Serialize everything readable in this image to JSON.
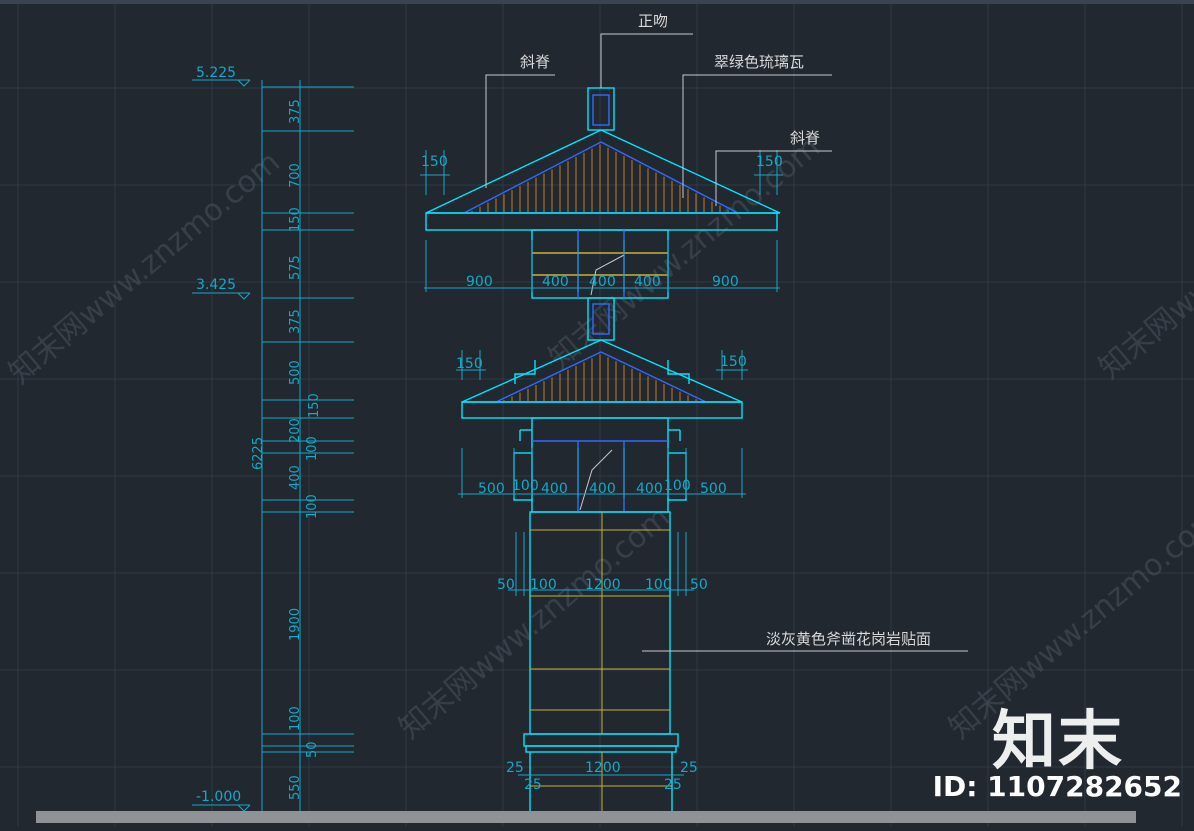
{
  "colors": {
    "background": "#212830",
    "grid": "#2f3a45",
    "outline": "#00e5ff",
    "inner": "#2f6bff",
    "stripe": "#c97a1e",
    "yellow": "#c8b040",
    "annotation": "#c9c9c9",
    "dimension": "#15a8c8"
  },
  "title_labels": {
    "ridge_top": "正吻",
    "hip_left": "斜脊",
    "tile_note": "翠绿色琉璃瓦",
    "hip_right": "斜脊",
    "cladding_note": "淡灰黄色斧凿花岗岩贴面"
  },
  "elevations": {
    "top": "5.225",
    "middle": "3.425",
    "bottom": "-1.000"
  },
  "vertical_dims": {
    "total": "6225",
    "segments": [
      "375",
      "700",
      "150",
      "575",
      "375",
      "500",
      "150",
      "200",
      "100",
      "400",
      "100",
      "1900",
      "100",
      "50",
      "550"
    ]
  },
  "horizontal_dims": {
    "upper_row": [
      "900",
      "400",
      "400",
      "400",
      "900"
    ],
    "upper_roof": [
      "150",
      "150"
    ],
    "middle_roof": [
      "150",
      "150"
    ],
    "middle_row": [
      "500",
      "100",
      "400",
      "400",
      "400",
      "100",
      "500"
    ],
    "shaft_row": [
      "50",
      "100",
      "1200",
      "100",
      "50"
    ],
    "base_row": [
      "25",
      "1200",
      "25"
    ],
    "base_sub": [
      "25",
      "25"
    ]
  },
  "watermark": {
    "brand": "知末",
    "id": "ID: 1107282652",
    "diagonal": "知末网www.znzmo.com"
  }
}
